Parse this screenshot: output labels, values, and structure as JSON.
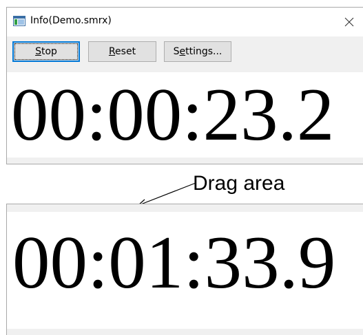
{
  "window": {
    "title": "Info(Demo.smrx)",
    "icon": "app-window-icon",
    "close_icon": "close-icon"
  },
  "toolbar": {
    "stop_label": "Stop",
    "stop_accel": "S",
    "stop_rest": "top",
    "reset_label": "Reset",
    "reset_accel": "R",
    "reset_rest": "eset",
    "settings_label": "Settings...",
    "settings_pre": "S",
    "settings_accel": "e",
    "settings_rest": "ttings..."
  },
  "timer_full": {
    "time": "00:00:23.2"
  },
  "annotation": {
    "text": "Drag area"
  },
  "timer_compact": {
    "time": "00:01:33.9"
  },
  "colors": {
    "default_button_border": "#0078d7",
    "button_face": "#e1e1e1",
    "window_background": "#f0f0f0"
  }
}
